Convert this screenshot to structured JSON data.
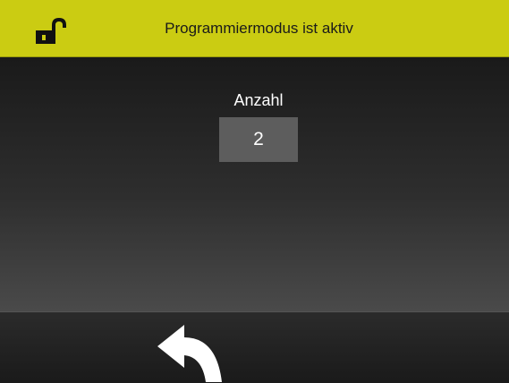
{
  "status_bar": {
    "title": "Programmiermodus ist aktiv",
    "icon": "unlocked-padlock-icon",
    "background_color": "#cbcc12"
  },
  "main": {
    "count_label": "Anzahl",
    "count_value": "2"
  },
  "footer": {
    "back_icon": "back-arrow-icon"
  }
}
